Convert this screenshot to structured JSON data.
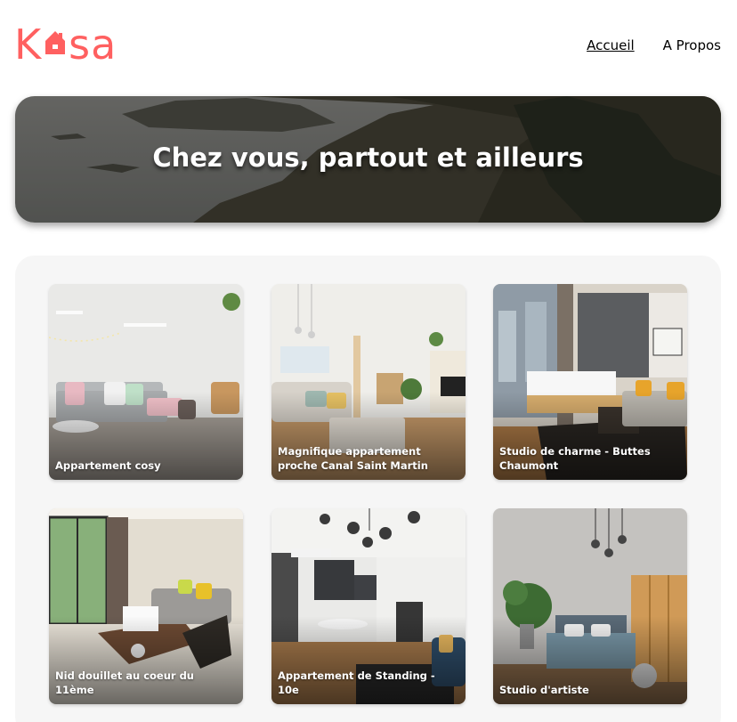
{
  "header": {
    "logo_text": "Kasa",
    "nav": [
      {
        "label": "Accueil",
        "active": true
      },
      {
        "label": "A Propos",
        "active": false
      }
    ]
  },
  "banner": {
    "title": "Chez vous, partout et ailleurs"
  },
  "listings": [
    {
      "title": "Appartement cosy"
    },
    {
      "title": "Magnifique appartement proche Canal Saint Martin"
    },
    {
      "title": "Studio de charme - Buttes Chaumont"
    },
    {
      "title": "Nid douillet au coeur du 11ème"
    },
    {
      "title": "Appartement de Standing - 10e"
    },
    {
      "title": "Studio d'artiste"
    }
  ],
  "colors": {
    "brand": "#FF6060",
    "gallery_bg": "#F6F6F6"
  }
}
